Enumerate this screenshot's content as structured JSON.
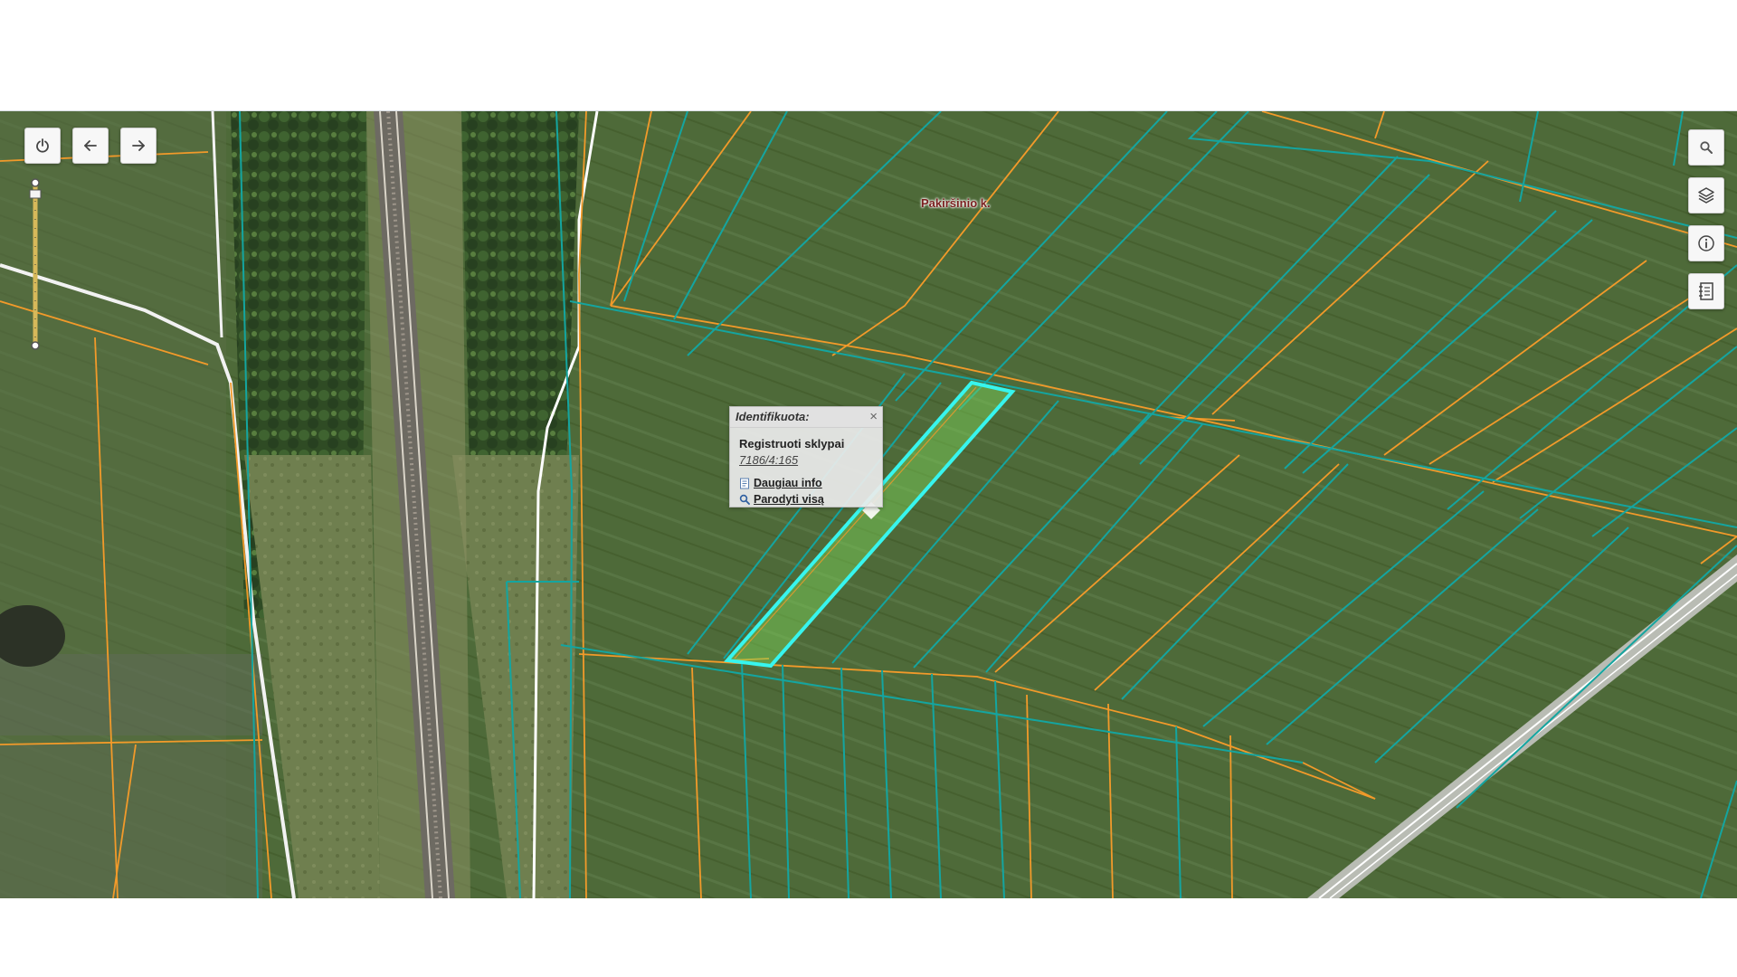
{
  "map": {
    "place_label": "Pakiršinio k.",
    "colors": {
      "parcel_outline": "#14a5a0",
      "cadastre_outline": "#f29a2a",
      "selected_outline": "#37f5ee",
      "selected_fill": "#7fd65a",
      "field": "#4f6a3a",
      "forest": "#2e4a22"
    }
  },
  "toolbar": {
    "left": [
      {
        "name": "power",
        "icon": "power-icon"
      },
      {
        "name": "back",
        "icon": "arrow-left-icon"
      },
      {
        "name": "forward",
        "icon": "arrow-right-icon"
      }
    ],
    "right": [
      {
        "name": "search",
        "icon": "search-icon"
      },
      {
        "name": "layers",
        "icon": "layers-icon"
      },
      {
        "name": "info",
        "icon": "info-icon"
      },
      {
        "name": "legend",
        "icon": "document-list-icon"
      }
    ]
  },
  "popup": {
    "title": "Identifikuota:",
    "close_glyph": "×",
    "layer_name": "Registruoti sklypai",
    "parcel_id": "7186/4:165",
    "more_info_label": "Daugiau info",
    "show_all_label": "Parodyti visą"
  }
}
